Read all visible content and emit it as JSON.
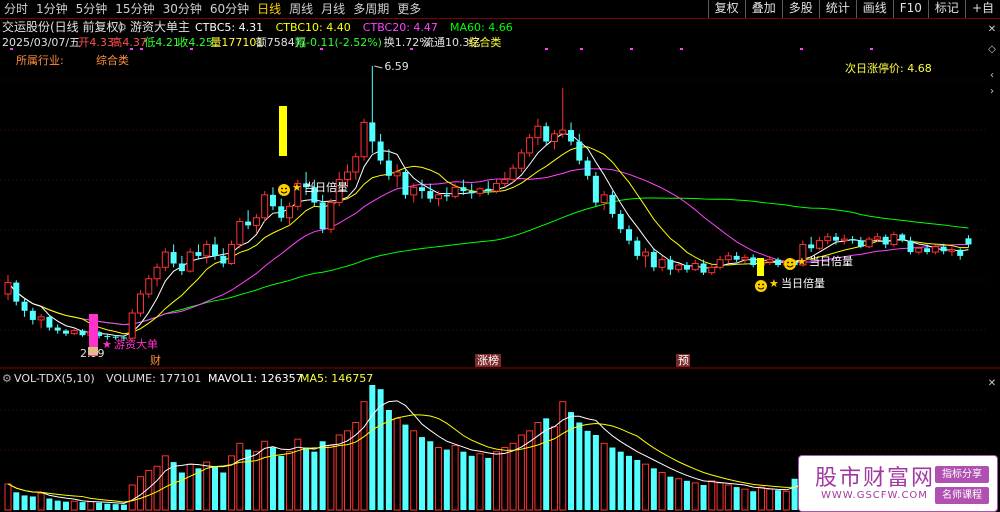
{
  "toolbar": {
    "periods": [
      "分时",
      "1分钟",
      "5分钟",
      "15分钟",
      "30分钟",
      "60分钟",
      "日线",
      "周线",
      "月线",
      "多周期",
      "更多"
    ],
    "active": "日线",
    "right_buttons": [
      "复权",
      "叠加",
      "多股",
      "统计",
      "画线",
      "F10",
      "标记",
      "+自"
    ]
  },
  "header": {
    "stock": "交运股份(日线 前复权)",
    "indicator": "游资大单主",
    "ma_values": [
      {
        "label": "CTBC5: 4.31",
        "color": "#ffffff"
      },
      {
        "label": "CTBC10: 4.40",
        "color": "#ffff00"
      },
      {
        "label": "CTBC20: 4.47",
        "color": "#ff44ff"
      },
      {
        "label": "MA60: 4.66",
        "color": "#00ff00"
      }
    ]
  },
  "info": {
    "date": "2025/03/07/五",
    "open": "开4.33",
    "high": "高4.37",
    "low": "低4.21",
    "close": "收4.25",
    "volume": "量177101",
    "amount": "额7584万",
    "change": "幅-0.11(-2.52%)",
    "turnover": "换1.72%",
    "float": "流通10.3亿",
    "sector": "综合类"
  },
  "industry": {
    "label": "所属行业:",
    "value": "综合类"
  },
  "limit_price": "次日涨停价: 4.68",
  "marks": {
    "max_price": "6.59",
    "min_price": "2.99",
    "yzdd": "游资大单",
    "bei": "当日倍量",
    "cai": "财",
    "zhangbang": "涨榜",
    "yu": "预"
  },
  "volume_header": {
    "name": "VOL-TDX(5,10)",
    "volume": "VOLUME: 177101",
    "mavol1": "MAVOL1: 126357",
    "ma5": "MA5: 146757"
  },
  "watermark": {
    "title": "股市财富网",
    "url": "WWW.GSCFW.COM",
    "tag1": "指标分享",
    "tag2": "名师课程"
  },
  "colors": {
    "up": "#ff3232",
    "down": "#54ffff",
    "ma5": "#ffffff",
    "ma10": "#ffff00",
    "ma20": "#ff44ff",
    "ma60": "#00ff00"
  },
  "chart_data": {
    "type": "candlestick",
    "ylim": [
      2.8,
      6.8
    ],
    "candles": [
      [
        3.6,
        3.85,
        3.52,
        3.75
      ],
      [
        3.75,
        3.78,
        3.45,
        3.5
      ],
      [
        3.5,
        3.55,
        3.3,
        3.38
      ],
      [
        3.38,
        3.42,
        3.2,
        3.26
      ],
      [
        3.26,
        3.34,
        3.15,
        3.3
      ],
      [
        3.3,
        3.32,
        3.12,
        3.16
      ],
      [
        3.16,
        3.2,
        3.08,
        3.12
      ],
      [
        3.12,
        3.14,
        3.05,
        3.08
      ],
      [
        3.08,
        3.15,
        3.06,
        3.12
      ],
      [
        3.12,
        3.14,
        3.04,
        3.06
      ],
      [
        3.06,
        3.12,
        3.03,
        3.1
      ],
      [
        3.1,
        3.12,
        3.02,
        3.05
      ],
      [
        3.05,
        3.08,
        3.0,
        3.04
      ],
      [
        3.04,
        3.06,
        3.0,
        3.03
      ],
      [
        3.03,
        3.05,
        2.99,
        3.02
      ],
      [
        3.02,
        3.4,
        3.0,
        3.35
      ],
      [
        3.35,
        3.65,
        3.3,
        3.6
      ],
      [
        3.6,
        3.85,
        3.55,
        3.8
      ],
      [
        3.8,
        4.0,
        3.7,
        3.95
      ],
      [
        3.95,
        4.2,
        3.9,
        4.15
      ],
      [
        4.15,
        4.25,
        3.95,
        4.0
      ],
      [
        4.0,
        4.1,
        3.85,
        3.9
      ],
      [
        3.9,
        4.2,
        3.88,
        4.15
      ],
      [
        4.15,
        4.25,
        4.05,
        4.1
      ],
      [
        4.1,
        4.3,
        4.0,
        4.25
      ],
      [
        4.25,
        4.35,
        4.05,
        4.1
      ],
      [
        4.1,
        4.2,
        3.95,
        4.0
      ],
      [
        4.0,
        4.3,
        3.98,
        4.25
      ],
      [
        4.25,
        4.6,
        4.2,
        4.55
      ],
      [
        4.55,
        4.7,
        4.45,
        4.5
      ],
      [
        4.5,
        4.65,
        4.4,
        4.6
      ],
      [
        4.6,
        4.95,
        4.55,
        4.9
      ],
      [
        4.9,
        5.0,
        4.7,
        4.75
      ],
      [
        4.75,
        4.85,
        4.55,
        4.6
      ],
      [
        4.6,
        4.8,
        4.5,
        4.75
      ],
      [
        4.75,
        5.1,
        4.7,
        5.05
      ],
      [
        5.05,
        5.2,
        4.9,
        5.0
      ],
      [
        5.0,
        5.1,
        4.75,
        4.8
      ],
      [
        4.8,
        4.9,
        4.4,
        4.45
      ],
      [
        4.45,
        4.85,
        4.4,
        4.8
      ],
      [
        4.8,
        5.2,
        4.75,
        5.1
      ],
      [
        5.1,
        5.3,
        5.0,
        5.2
      ],
      [
        5.2,
        5.45,
        5.1,
        5.4
      ],
      [
        5.4,
        5.9,
        5.35,
        5.85
      ],
      [
        5.85,
        6.59,
        5.45,
        5.6
      ],
      [
        5.6,
        5.7,
        5.3,
        5.35
      ],
      [
        5.35,
        5.5,
        5.1,
        5.15
      ],
      [
        5.15,
        5.3,
        5.0,
        5.2
      ],
      [
        5.2,
        5.25,
        4.85,
        4.9
      ],
      [
        4.9,
        5.05,
        4.8,
        5.0
      ],
      [
        5.0,
        5.1,
        4.85,
        4.95
      ],
      [
        4.95,
        5.05,
        4.8,
        4.85
      ],
      [
        4.85,
        4.95,
        4.75,
        4.9
      ],
      [
        4.9,
        5.0,
        4.82,
        4.88
      ],
      [
        4.88,
        5.05,
        4.85,
        5.0
      ],
      [
        5.0,
        5.1,
        4.9,
        4.95
      ],
      [
        4.95,
        5.05,
        4.85,
        4.92
      ],
      [
        4.92,
        5.0,
        4.88,
        4.98
      ],
      [
        4.98,
        5.08,
        4.9,
        4.95
      ],
      [
        4.95,
        5.1,
        4.92,
        5.05
      ],
      [
        5.05,
        5.2,
        5.0,
        5.1
      ],
      [
        5.1,
        5.3,
        5.05,
        5.25
      ],
      [
        5.25,
        5.5,
        5.2,
        5.45
      ],
      [
        5.45,
        5.7,
        5.4,
        5.65
      ],
      [
        5.65,
        5.9,
        5.55,
        5.8
      ],
      [
        5.8,
        5.85,
        5.55,
        5.6
      ],
      [
        5.6,
        5.75,
        5.5,
        5.7
      ],
      [
        5.7,
        6.3,
        5.65,
        5.75
      ],
      [
        5.75,
        5.85,
        5.55,
        5.6
      ],
      [
        5.6,
        5.7,
        5.3,
        5.35
      ],
      [
        5.35,
        5.4,
        5.1,
        5.15
      ],
      [
        5.15,
        5.2,
        4.75,
        4.8
      ],
      [
        4.8,
        4.95,
        4.7,
        4.9
      ],
      [
        4.9,
        4.95,
        4.6,
        4.65
      ],
      [
        4.65,
        4.7,
        4.4,
        4.45
      ],
      [
        4.45,
        4.5,
        4.25,
        4.3
      ],
      [
        4.3,
        4.35,
        4.05,
        4.1
      ],
      [
        4.1,
        4.2,
        3.95,
        4.15
      ],
      [
        4.15,
        4.2,
        3.9,
        3.95
      ],
      [
        3.95,
        4.1,
        3.9,
        4.05
      ],
      [
        4.05,
        4.1,
        3.85,
        3.92
      ],
      [
        3.92,
        4.0,
        3.88,
        3.98
      ],
      [
        3.98,
        4.02,
        3.88,
        3.92
      ],
      [
        3.92,
        4.05,
        3.9,
        4.0
      ],
      [
        4.0,
        4.05,
        3.85,
        3.88
      ],
      [
        3.88,
        3.98,
        3.85,
        3.95
      ],
      [
        3.95,
        4.1,
        3.92,
        4.05
      ],
      [
        4.05,
        4.15,
        4.0,
        4.1
      ],
      [
        4.1,
        4.15,
        4.02,
        4.05
      ],
      [
        4.05,
        4.12,
        4.0,
        4.08
      ],
      [
        4.08,
        4.12,
        3.95,
        3.98
      ],
      [
        3.98,
        4.05,
        3.92,
        4.02
      ],
      [
        4.02,
        4.1,
        3.98,
        4.05
      ],
      [
        4.05,
        4.08,
        3.95,
        3.98
      ],
      [
        3.98,
        4.05,
        3.95,
        4.02
      ],
      [
        4.02,
        4.05,
        3.95,
        3.98
      ],
      [
        3.98,
        4.3,
        3.96,
        4.25
      ],
      [
        4.25,
        4.35,
        4.15,
        4.2
      ],
      [
        4.2,
        4.35,
        4.18,
        4.3
      ],
      [
        4.3,
        4.4,
        4.25,
        4.35
      ],
      [
        4.35,
        4.4,
        4.25,
        4.3
      ],
      [
        4.3,
        4.38,
        4.25,
        4.32
      ],
      [
        4.32,
        4.36,
        4.26,
        4.3
      ],
      [
        4.3,
        4.35,
        4.2,
        4.22
      ],
      [
        4.22,
        4.35,
        4.2,
        4.32
      ],
      [
        4.32,
        4.4,
        4.28,
        4.35
      ],
      [
        4.35,
        4.38,
        4.2,
        4.25
      ],
      [
        4.25,
        4.42,
        4.22,
        4.38
      ],
      [
        4.38,
        4.4,
        4.28,
        4.3
      ],
      [
        4.3,
        4.35,
        4.12,
        4.15
      ],
      [
        4.15,
        4.22,
        4.12,
        4.2
      ],
      [
        4.2,
        4.25,
        4.12,
        4.15
      ],
      [
        4.15,
        4.25,
        4.12,
        4.22
      ],
      [
        4.22,
        4.26,
        4.12,
        4.16
      ],
      [
        4.16,
        4.22,
        4.1,
        4.18
      ],
      [
        4.18,
        4.2,
        4.05,
        4.1
      ],
      [
        4.33,
        4.37,
        4.21,
        4.25
      ]
    ],
    "volume": [
      125,
      85,
      70,
      65,
      80,
      55,
      45,
      40,
      42,
      38,
      40,
      35,
      30,
      28,
      26,
      120,
      160,
      190,
      210,
      260,
      230,
      180,
      220,
      200,
      230,
      210,
      180,
      260,
      320,
      290,
      280,
      330,
      300,
      260,
      280,
      340,
      300,
      280,
      330,
      310,
      360,
      380,
      420,
      520,
      600,
      580,
      480,
      440,
      410,
      380,
      350,
      330,
      300,
      290,
      310,
      280,
      260,
      270,
      250,
      280,
      300,
      320,
      360,
      380,
      420,
      440,
      400,
      520,
      470,
      420,
      380,
      360,
      320,
      300,
      280,
      260,
      240,
      220,
      200,
      180,
      160,
      150,
      140,
      130,
      120,
      140,
      130,
      120,
      110,
      100,
      90,
      110,
      100,
      95,
      90,
      150,
      200,
      180,
      170,
      160,
      150,
      140,
      130,
      120,
      140,
      160,
      150,
      170,
      140,
      130,
      150,
      170,
      160,
      160,
      150,
      177
    ]
  }
}
